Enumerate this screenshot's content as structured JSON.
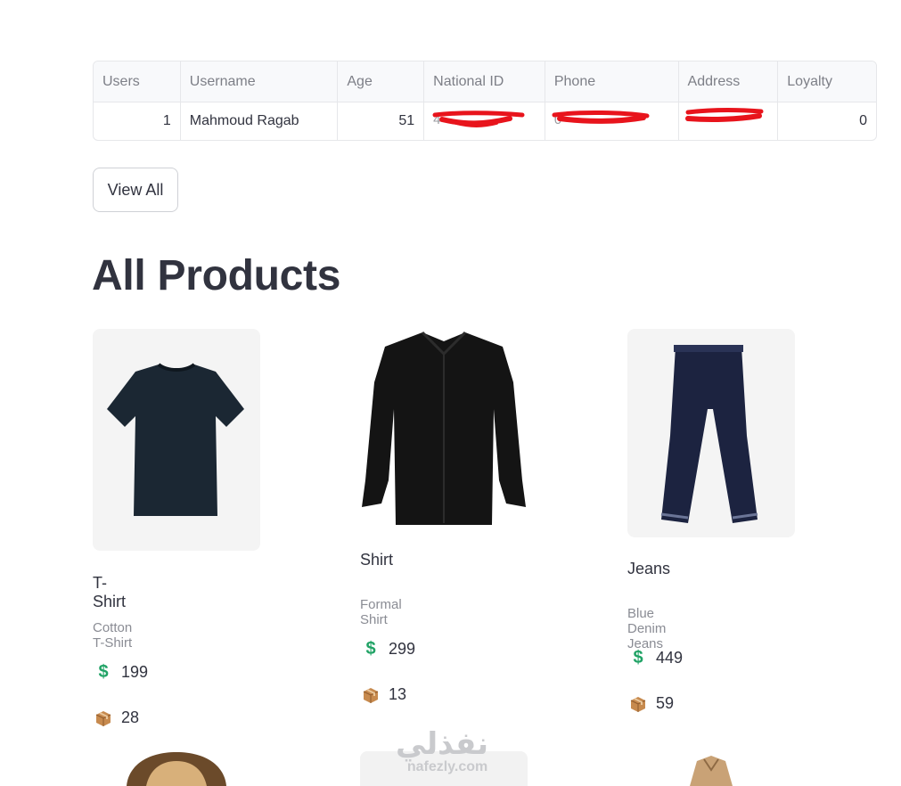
{
  "table": {
    "headers": [
      "Users",
      "Username",
      "Age",
      "National ID",
      "Phone",
      "Address",
      "Loyalty"
    ],
    "row": {
      "users": "1",
      "username": "Mahmoud Ragab",
      "age": "51",
      "national_id": "4",
      "phone": "0",
      "address": "",
      "loyalty": "0"
    }
  },
  "buttons": {
    "view_all": "View All"
  },
  "heading": "All Products",
  "products": [
    {
      "name": "T-Shirt",
      "description": "Cotton T-Shirt",
      "price": "199",
      "stock": "28",
      "icon": "tshirt-image"
    },
    {
      "name": "Shirt",
      "description": "Formal Shirt",
      "price": "299",
      "stock": "13",
      "icon": "shirt-image"
    },
    {
      "name": "Jeans",
      "description": "Blue Denim Jeans",
      "price": "449",
      "stock": "59",
      "icon": "jeans-image"
    }
  ],
  "icons": {
    "price": "dollar-icon",
    "stock": "package-icon"
  },
  "colors": {
    "price_icon": "#21a366",
    "redaction": "#e8141c"
  },
  "watermark": {
    "arabic": "نفذلي",
    "latin": "nafezly.com"
  }
}
